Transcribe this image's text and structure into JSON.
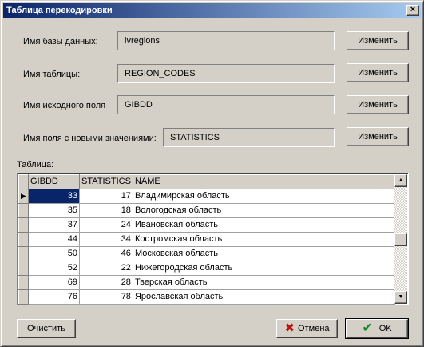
{
  "window": {
    "title": "Таблица перекодировки",
    "close_glyph": "×"
  },
  "form": {
    "db_name_label": "Имя базы данных:",
    "db_name_value": "lvregions",
    "table_name_label": "Имя таблицы:",
    "table_name_value": "REGION_CODES",
    "source_field_label": "Имя исходного поля",
    "source_field_value": "GIBDD",
    "new_field_label": "Имя поля с новыми значениями:",
    "new_field_value": "STATISTICS",
    "change_label": "Изменить"
  },
  "grid": {
    "caption": "Таблица:",
    "columns": [
      "GIBDD",
      "STATISTICS",
      "NAME"
    ],
    "row_indicator": "▶",
    "rows": [
      [
        "33",
        "17",
        "Владимирская область"
      ],
      [
        "35",
        "18",
        "Вологодская область"
      ],
      [
        "37",
        "24",
        "Ивановская область"
      ],
      [
        "44",
        "34",
        "Костромская область"
      ],
      [
        "50",
        "46",
        "Московская область"
      ],
      [
        "52",
        "22",
        "Нижегородская область"
      ],
      [
        "69",
        "28",
        "Тверская область"
      ],
      [
        "76",
        "78",
        "Ярославская область"
      ]
    ],
    "scroll_up": "▲",
    "scroll_down": "▼"
  },
  "footer": {
    "clear_label": "Очистить",
    "cancel_label": "Отмена",
    "ok_label": "OK",
    "cancel_icon": "close-icon",
    "ok_icon": "check-icon"
  }
}
